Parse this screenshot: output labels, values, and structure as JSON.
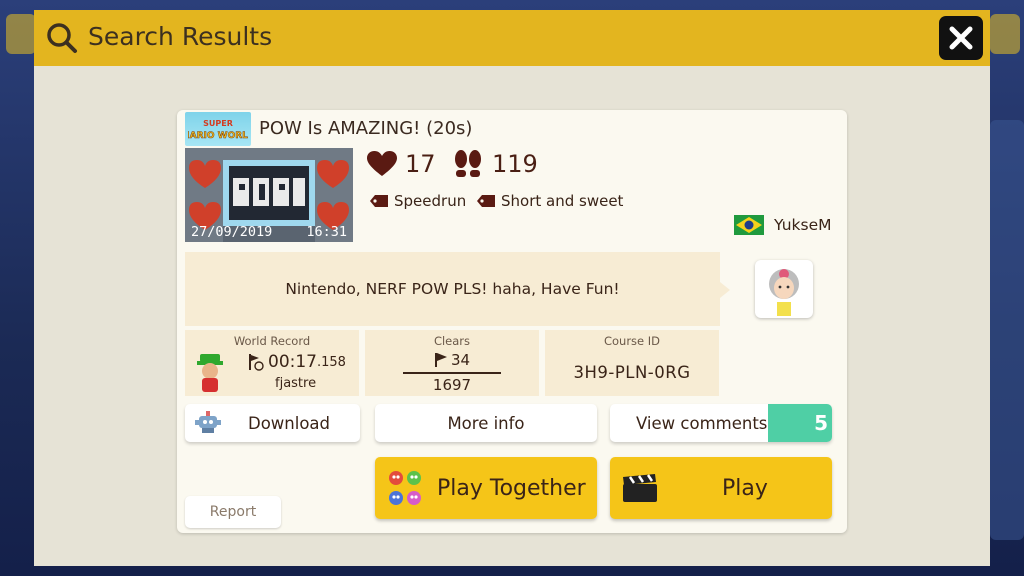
{
  "header": {
    "title": "Search Results",
    "search_icon": "search-icon",
    "close_icon": "close-icon"
  },
  "course": {
    "game_logo": "Super Mario World",
    "title": "POW Is AMAZING! (20s)",
    "date": "27/09/2019",
    "time": "16:31",
    "likes": "17",
    "plays": "119",
    "tags": [
      "Speedrun",
      "Short and sweet"
    ],
    "maker_name": "YukseM",
    "maker_country_flag": "flag-brazil",
    "comment": "Nintendo, NERF POW PLS! haha, Have Fun!"
  },
  "stats": {
    "world_record_label": "World Record",
    "world_record_time_main": "00:17",
    "world_record_time_ms": ".158",
    "world_record_holder": "fjastre",
    "clears_label": "Clears",
    "clears": "34",
    "attempts": "1697",
    "course_id_label": "Course ID",
    "course_id": "3H9-PLN-0RG"
  },
  "buttons": {
    "download": "Download",
    "more_info": "More info",
    "view_comments": "View comments",
    "comments_count": "5",
    "play_together": "Play Together",
    "play": "Play",
    "report": "Report"
  },
  "colors": {
    "header_bg": "#e3b51f",
    "modal_bg": "#e6e3d6",
    "card_bg": "#fbf9f0",
    "panel_bg": "#f7ecd4",
    "play_button": "#f5c518",
    "comments_badge": "#4fcfa5"
  }
}
